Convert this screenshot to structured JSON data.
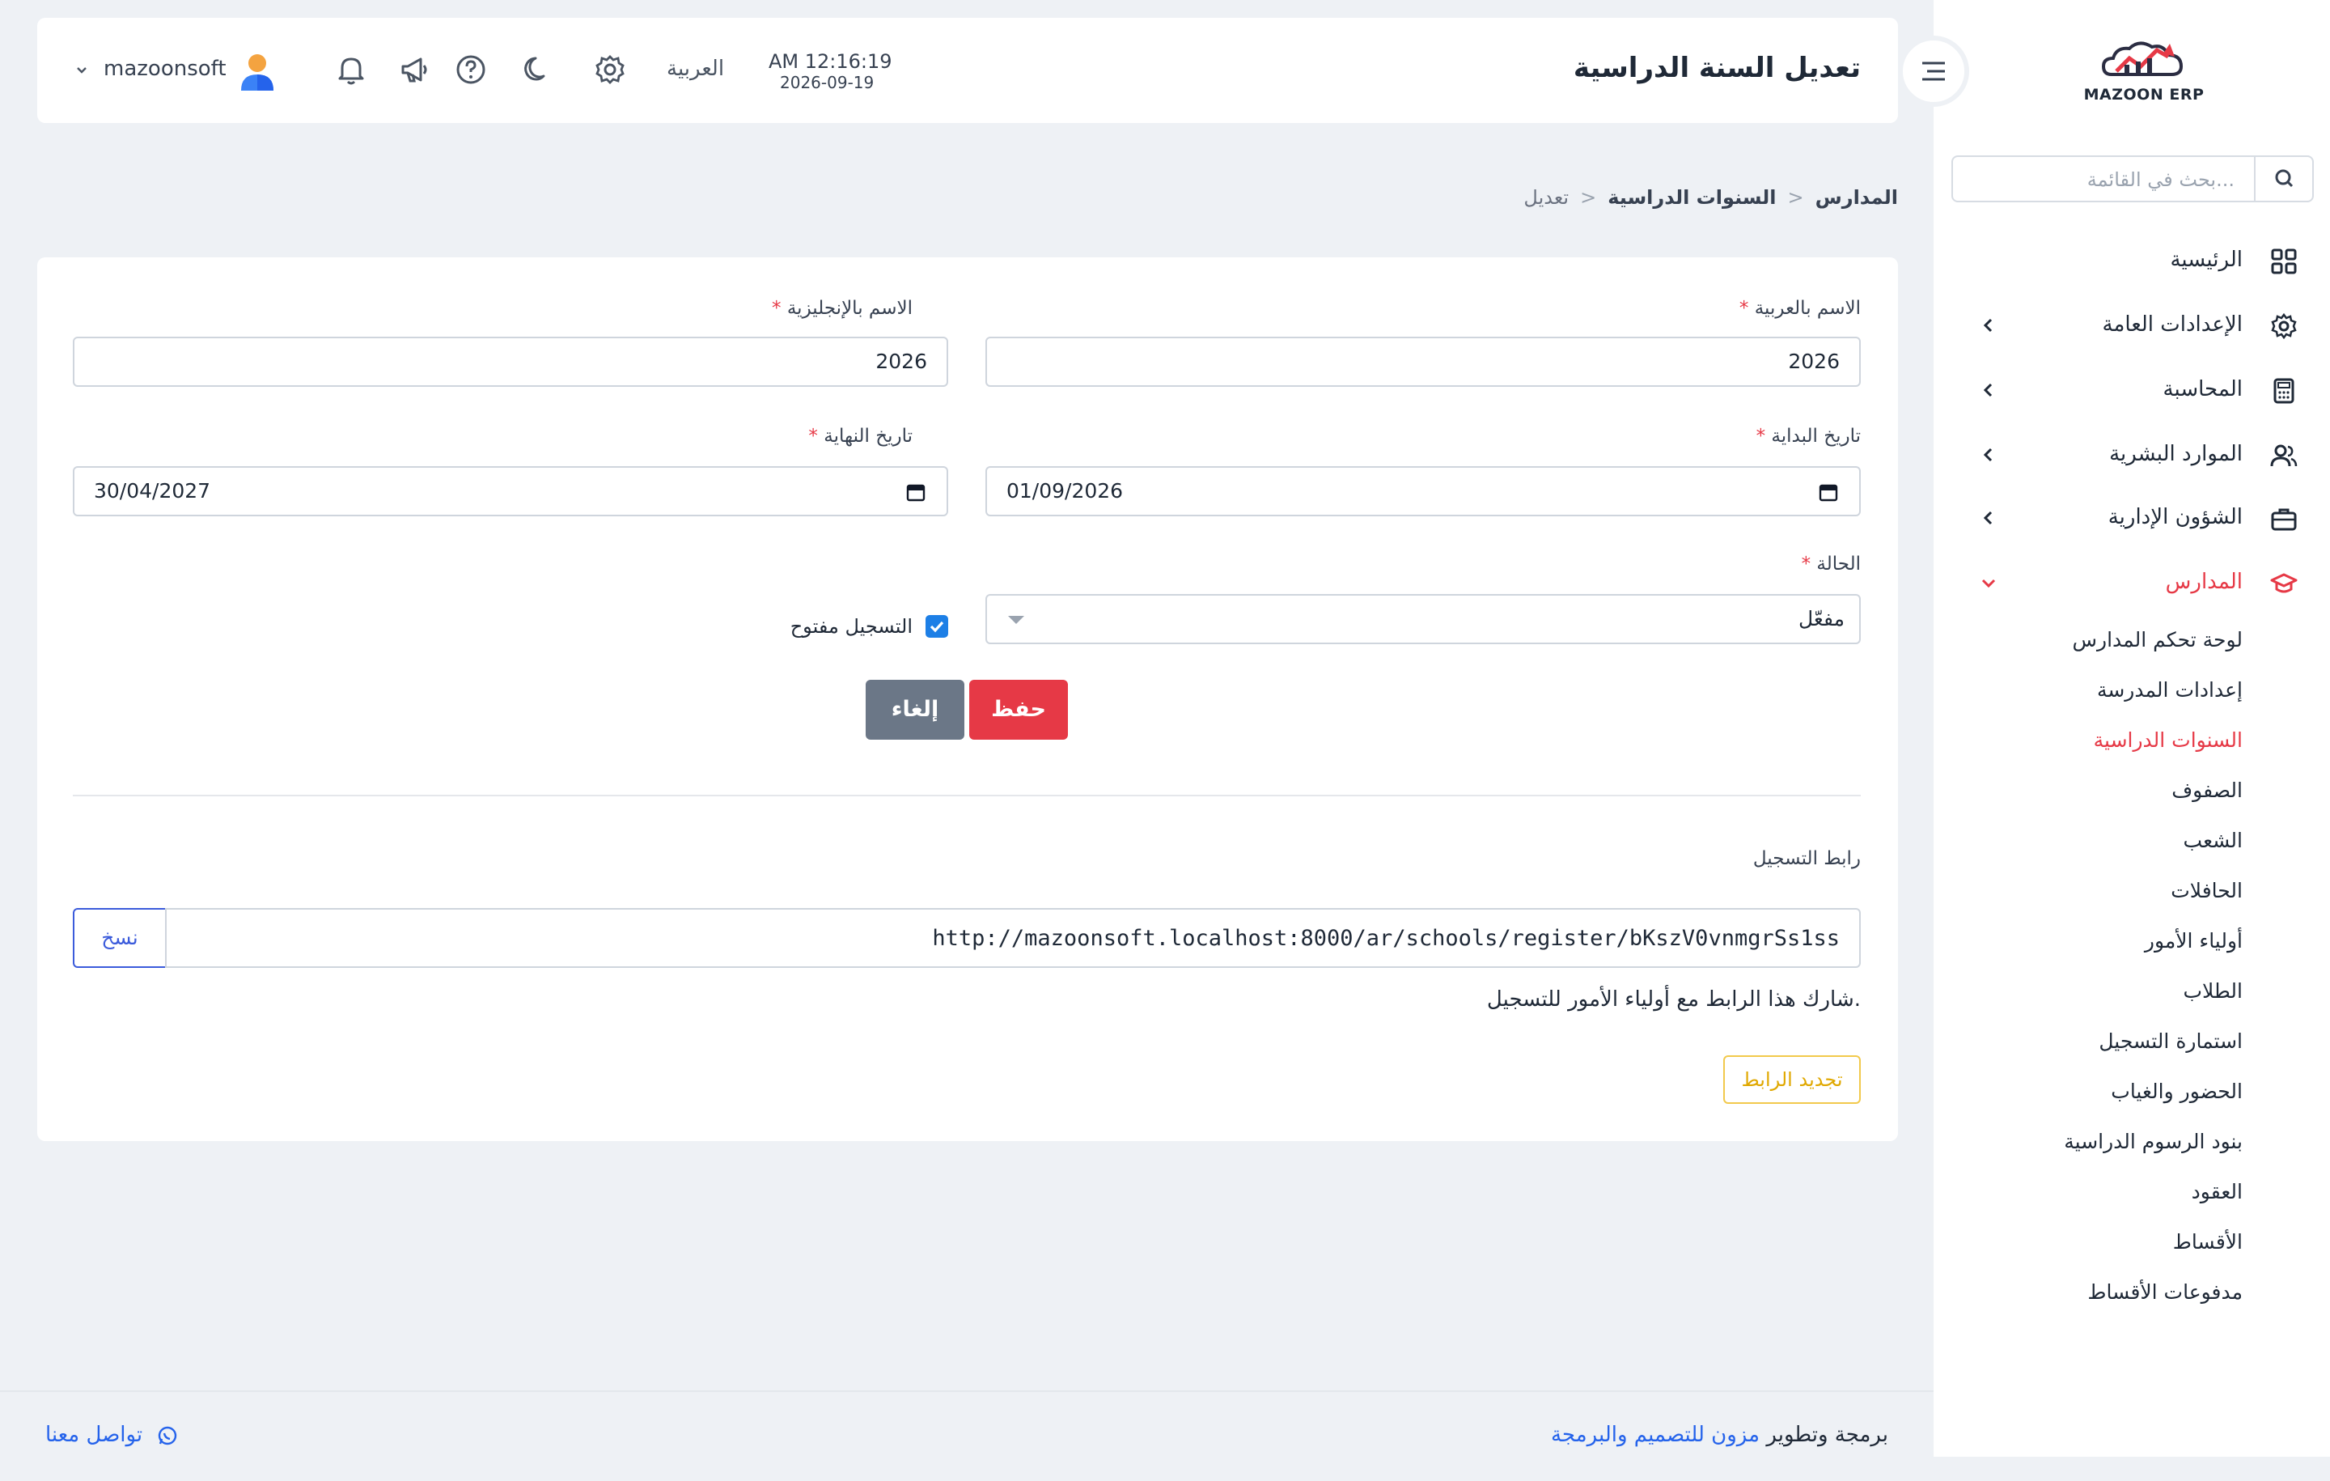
{
  "sidebar": {
    "logo_text": "MAZOON ERP",
    "search_placeholder": "بحث في القائمة...",
    "items": [
      {
        "label": "الرئيسية"
      },
      {
        "label": "الإعدادات العامة"
      },
      {
        "label": "المحاسبة"
      },
      {
        "label": "الموارد البشرية"
      },
      {
        "label": "الشؤون الإدارية"
      },
      {
        "label": "المدارس"
      }
    ],
    "school_subitems": [
      {
        "label": "لوحة تحكم المدارس"
      },
      {
        "label": "إعدادات المدرسة"
      },
      {
        "label": "السنوات الدراسية"
      },
      {
        "label": "الصفوف"
      },
      {
        "label": "الشعب"
      },
      {
        "label": "الحافلات"
      },
      {
        "label": "أولياء الأمور"
      },
      {
        "label": "الطلاب"
      },
      {
        "label": "استمارة التسجيل"
      },
      {
        "label": "الحضور والغياب"
      },
      {
        "label": "بنود الرسوم الدراسية"
      },
      {
        "label": "العقود"
      },
      {
        "label": "الأقساط"
      },
      {
        "label": "مدفوعات الأقساط"
      }
    ],
    "active_subitem": "السنوات الدراسية"
  },
  "header": {
    "title": "تعديل السنة الدراسية",
    "time": "AM 12:16:19",
    "date": "2026-09-19",
    "language": "العربية",
    "username": "mazoonsoft"
  },
  "breadcrumb": {
    "level1": "المدارس",
    "level2": "السنوات الدراسية",
    "level3": "تعديل",
    "separator": "<"
  },
  "form": {
    "name_ar_label": "الاسم بالعربية",
    "name_ar_value": "2026",
    "name_en_label": "الاسم بالإنجليزية",
    "name_en_value": "2026",
    "start_label": "تاريخ البداية",
    "start_value": "01/09/2026",
    "end_label": "تاريخ النهاية",
    "end_value": "30/04/2027",
    "status_label": "الحالة",
    "status_value": "مفعّل",
    "registration_open_label": "التسجيل مفتوح",
    "registration_open": true,
    "required_mark": "*",
    "save_label": "حفظ",
    "cancel_label": "إلغاء"
  },
  "registration": {
    "link_label": "رابط التسجيل",
    "url": "http://mazoonsoft.localhost:8000/ar/schools/register/bKszV0vnmgrSs1ss",
    "copy_label": "نسخ",
    "share_note": "شارك هذا الرابط مع أولياء الأمور للتسجيل.",
    "renew_label": "تجديد الرابط"
  },
  "footer": {
    "credit_prefix": "برمجة وتطوير",
    "company": "مزون للتصميم والبرمجة",
    "contact_label": "تواصل معنا"
  },
  "colors": {
    "primary_red": "#e63946",
    "cancel_gray": "#6b7787",
    "link_blue": "#2563eb",
    "copy_blue": "#3b5bdb",
    "warning_yellow": "#e0a800",
    "checkbox_blue": "#1d7fe6"
  }
}
